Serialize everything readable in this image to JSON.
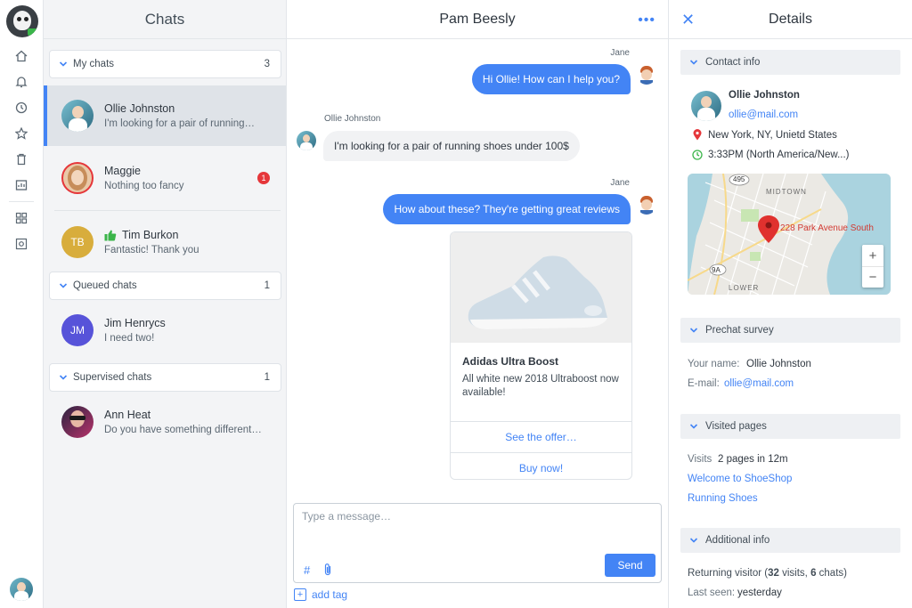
{
  "chats_panel": {
    "title": "Chats",
    "groups": [
      {
        "label": "My chats",
        "count": "3"
      },
      {
        "label": "Queued chats",
        "count": "1"
      },
      {
        "label": "Supervised chats",
        "count": "1"
      }
    ],
    "items": [
      {
        "name": "Ollie Johnston",
        "message": "I'm looking for a pair of running…"
      },
      {
        "name": "Maggie",
        "message": "Nothing too fancy",
        "unread": "1"
      },
      {
        "name": "Tim Burkon",
        "message": "Fantastic! Thank you",
        "initials": "TB"
      },
      {
        "name": "Jim Henrycs",
        "message": "I need two!",
        "initials": "JM"
      },
      {
        "name": "Ann Heat",
        "message": "Do you have something different…"
      }
    ]
  },
  "conversation": {
    "title": "Pam Beesly",
    "messages": [
      {
        "author": "Jane",
        "text": "Hi Ollie! How can I help you?"
      },
      {
        "author": "Ollie Johnston",
        "text": "I'm looking for a pair of running shoes under 100$"
      },
      {
        "author": "Jane",
        "text": "How about these? They're getting great reviews"
      }
    ],
    "card": {
      "title": "Adidas Ultra Boost",
      "description": "All white new 2018 Ultraboost now available!",
      "action1": "See the offer…",
      "action2": "Buy now!"
    },
    "composer": {
      "placeholder": "Type a message…",
      "hash": "#",
      "send_label": "Send",
      "add_tag": "add tag"
    }
  },
  "details": {
    "title": "Details",
    "contact": {
      "header": "Contact info",
      "name": "Ollie Johnston",
      "email": "ollie@mail.com",
      "location": "New York, NY, Unietd States",
      "time": "3:33PM (North America/New...)"
    },
    "map": {
      "address": "228 Park Avenue South",
      "labels": [
        "MIDTOWN",
        "LOWER",
        "495",
        "9A"
      ],
      "zoom_in": "+",
      "zoom_out": "−"
    },
    "prechat": {
      "header": "Prechat survey",
      "name_label": "Your name:",
      "name_value": "Ollie Johnston",
      "email_label": "E-mail:",
      "email_value": "ollie@mail.com"
    },
    "visited": {
      "header": "Visited pages",
      "visits_label": "Visits",
      "visits_value": "2 pages in 12m",
      "pages": [
        "Welcome to ShoeShop",
        "Running Shoes"
      ]
    },
    "additional": {
      "header": "Additional info",
      "returning_prefix": "Returning visitor (",
      "visits_count": "32",
      "visits_word": " visits, ",
      "chats_count": "6",
      "chats_word": " chats)",
      "last_seen_label": "Last seen:",
      "last_seen_value": "yesterday"
    }
  },
  "colors": {
    "accent": "#4384f5",
    "badge": "#e5363a",
    "like": "#3bb54a"
  }
}
